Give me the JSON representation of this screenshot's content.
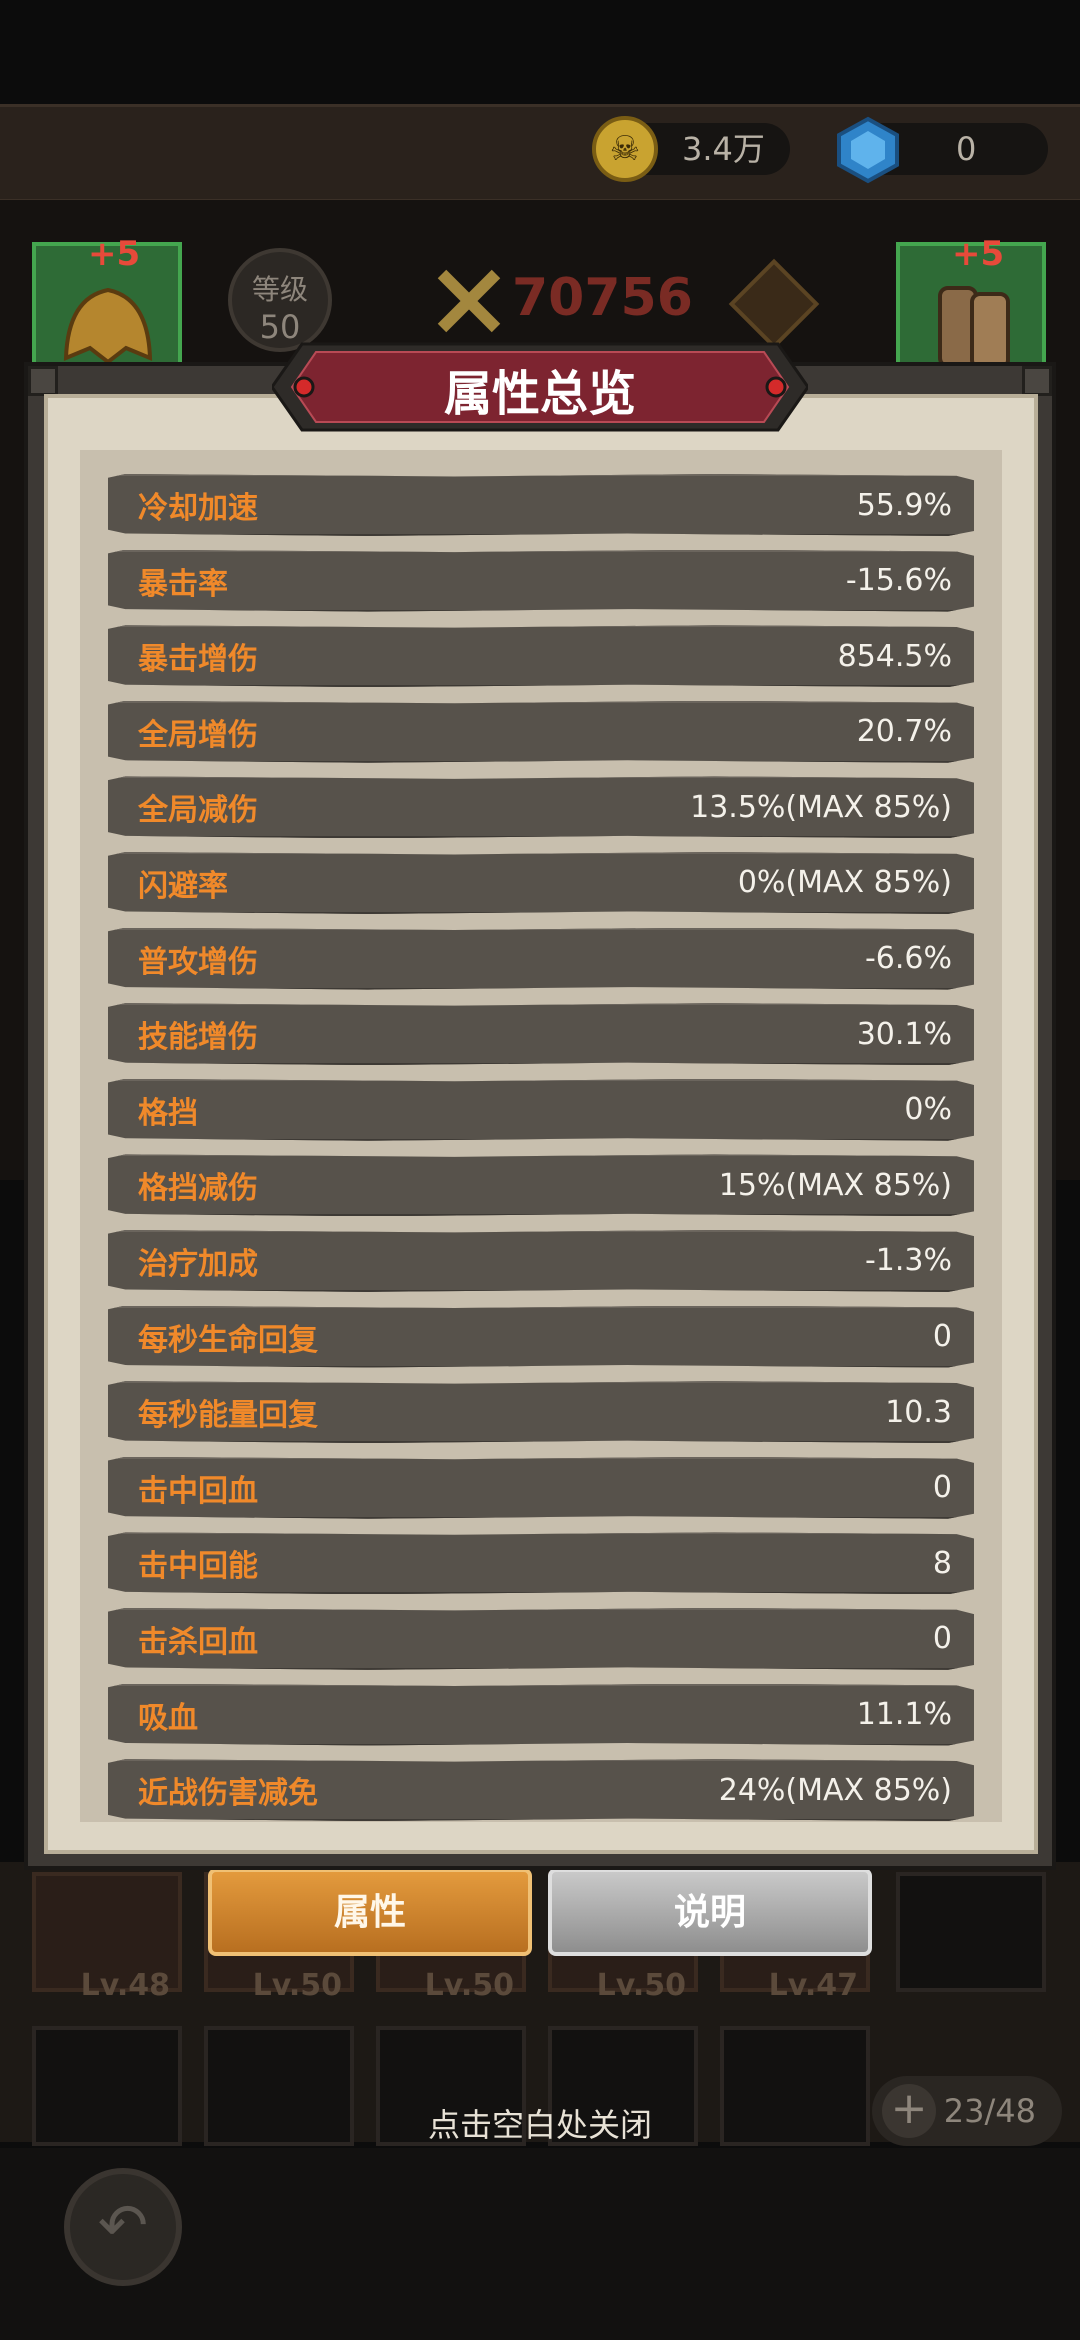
{
  "currency": {
    "coins": "3.4万",
    "gems": "0"
  },
  "hero": {
    "level_label": "等级",
    "level_value": "50",
    "power": "70756",
    "left_slot_bonus": "+5",
    "right_slot_bonus": "+5"
  },
  "modal": {
    "title": "属性总览",
    "stats": [
      {
        "label": "冷却加速",
        "value": "55.9%"
      },
      {
        "label": "暴击率",
        "value": "-15.6%"
      },
      {
        "label": "暴击增伤",
        "value": "854.5%"
      },
      {
        "label": "全局增伤",
        "value": "20.7%"
      },
      {
        "label": "全局减伤",
        "value": "13.5%(MAX 85%)"
      },
      {
        "label": "闪避率",
        "value": "0%(MAX 85%)"
      },
      {
        "label": "普攻增伤",
        "value": "-6.6%"
      },
      {
        "label": "技能增伤",
        "value": "30.1%"
      },
      {
        "label": "格挡",
        "value": "0%"
      },
      {
        "label": "格挡减伤",
        "value": "15%(MAX 85%)"
      },
      {
        "label": "治疗加成",
        "value": "-1.3%"
      },
      {
        "label": "每秒生命回复",
        "value": "0"
      },
      {
        "label": "每秒能量回复",
        "value": "10.3"
      },
      {
        "label": "击中回血",
        "value": "0"
      },
      {
        "label": "击中回能",
        "value": "8"
      },
      {
        "label": "击杀回血",
        "value": "0"
      },
      {
        "label": "吸血",
        "value": "11.1%"
      },
      {
        "label": "近战伤害减免",
        "value": "24%(MAX 85%)"
      }
    ]
  },
  "tabs": {
    "attributes": "属性",
    "description": "说明"
  },
  "inventory": {
    "levels": [
      "Lv.48",
      "Lv.50",
      "Lv.50",
      "Lv.50",
      "Lv.47"
    ],
    "count": "23/48"
  },
  "close_hint": "点击空白处关闭",
  "colors": {
    "stat_label": "#f0892a",
    "stat_value": "#f4f1ea",
    "title_plate": "#7d2430"
  }
}
